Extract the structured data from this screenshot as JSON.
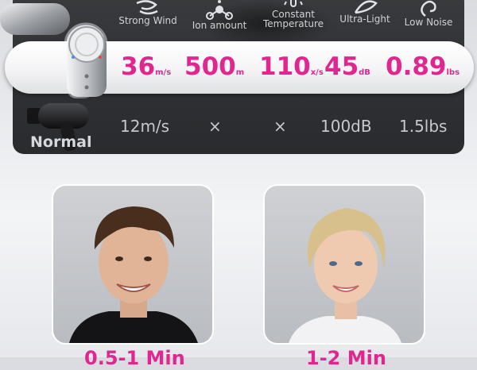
{
  "features": [
    {
      "label": "Strong Wind",
      "icon": "wind-icon"
    },
    {
      "label": "Ion amount",
      "icon": "ion-icon"
    },
    {
      "label": "Constant Temperature",
      "icon": "thermometer-icon"
    },
    {
      "label": "Ultra-Light",
      "icon": "feather-icon"
    },
    {
      "label": "Low Noise",
      "icon": "ear-icon"
    }
  ],
  "highlight_row": {
    "wind": {
      "value": "36",
      "unit": "m/s"
    },
    "ion": {
      "value": "500",
      "unit": "m"
    },
    "temp": {
      "value": "110",
      "unit": "x/s"
    },
    "noise": {
      "value": "45",
      "unit": "dB"
    },
    "weight": {
      "value": "0.89",
      "unit": "lbs"
    }
  },
  "normal_row": {
    "label": "Normal",
    "wind": "12m/s",
    "ion": "×",
    "temp": "×",
    "noise": "100dB",
    "weight": "1.5lbs"
  },
  "dry_times": {
    "short_hair": "0.5-1 Min",
    "long_hair": "1-2 Min"
  },
  "colors": {
    "accent": "#e2268f",
    "panel": "#2f3033",
    "muted_text": "#c6c8cc"
  }
}
